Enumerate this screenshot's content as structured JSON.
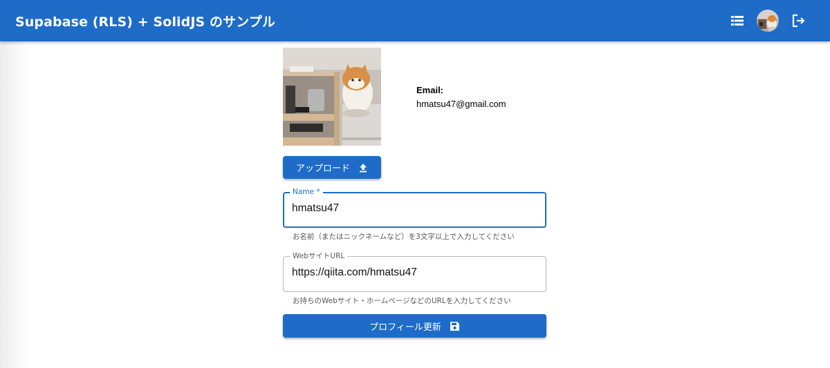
{
  "header": {
    "title": "Supabase (RLS) + SolidJS のサンプル",
    "bar_color": "#1e6cc7",
    "icons": {
      "list": "list-icon",
      "avatar": "user-avatar",
      "logout": "logout-icon"
    }
  },
  "profile": {
    "email_label": "Email:",
    "email_value": "hmatsu47@gmail.com",
    "upload_label": "アップロード",
    "upload_icon": "upload-icon"
  },
  "form": {
    "name": {
      "legend": "Name *",
      "value": "hmatsu47",
      "helper": "お名前（またはニックネームなど）を3文字以上で入力してください"
    },
    "website": {
      "legend": "WebサイトURL",
      "value": "https://qiita.com/hmatsu47",
      "helper": "お持ちのWebサイト・ホームページなどのURLを入力してください"
    },
    "submit_label": "プロフィール更新",
    "submit_icon": "save-icon"
  }
}
